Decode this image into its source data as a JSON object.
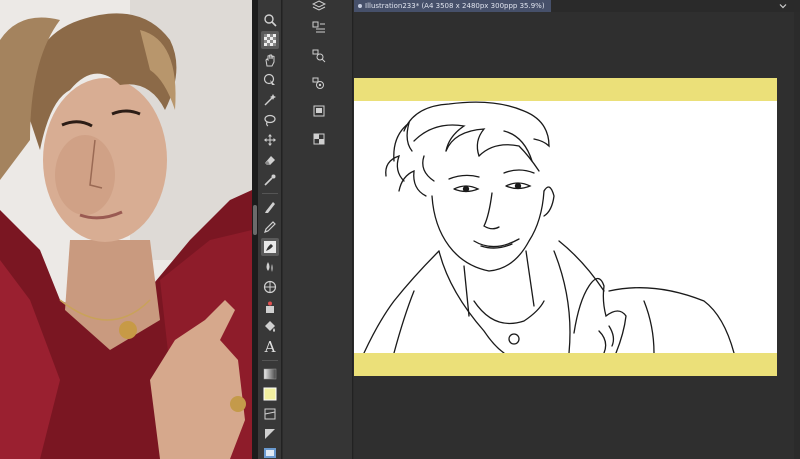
{
  "document": {
    "tab_title": "Illustration233* (A4 3508 x 2480px 300ppp 35.9%)"
  },
  "reference_panel": {
    "content": "reference photo"
  },
  "tools": [
    {
      "name": "zoom",
      "icon": "magnifier-icon"
    },
    {
      "name": "pattern",
      "icon": "checker-icon"
    },
    {
      "name": "hand",
      "icon": "hand-icon"
    },
    {
      "name": "operation",
      "icon": "object-select-icon"
    },
    {
      "name": "auto-select",
      "icon": "magic-wand-icon"
    },
    {
      "name": "selection",
      "icon": "lasso-icon"
    },
    {
      "name": "move",
      "icon": "move-icon"
    },
    {
      "name": "eraser",
      "icon": "eraser-icon"
    },
    {
      "name": "eyedropper",
      "icon": "eyedropper-icon"
    },
    {
      "name": "pen",
      "icon": "pen-icon"
    },
    {
      "name": "pencil",
      "icon": "pencil-icon"
    },
    {
      "name": "brush",
      "icon": "brush-icon"
    },
    {
      "name": "blend",
      "icon": "blend-icon"
    },
    {
      "name": "airbrush",
      "icon": "airbrush-icon"
    },
    {
      "name": "decoration",
      "icon": "decoration-icon"
    },
    {
      "name": "fill",
      "icon": "fill-icon"
    },
    {
      "name": "text",
      "icon": "text-icon"
    },
    {
      "name": "gradient",
      "icon": "gradient-icon"
    },
    {
      "name": "color",
      "icon": "color-swatch-icon"
    },
    {
      "name": "frame",
      "icon": "frame-icon"
    },
    {
      "name": "ruler",
      "icon": "ruler-icon"
    },
    {
      "name": "balloon",
      "icon": "balloon-icon"
    }
  ],
  "text_tool_label": "A",
  "colors": {
    "accent_tab": "#46506a",
    "canvas_border": "#ebe079",
    "current_color": "#f2f0a0"
  }
}
